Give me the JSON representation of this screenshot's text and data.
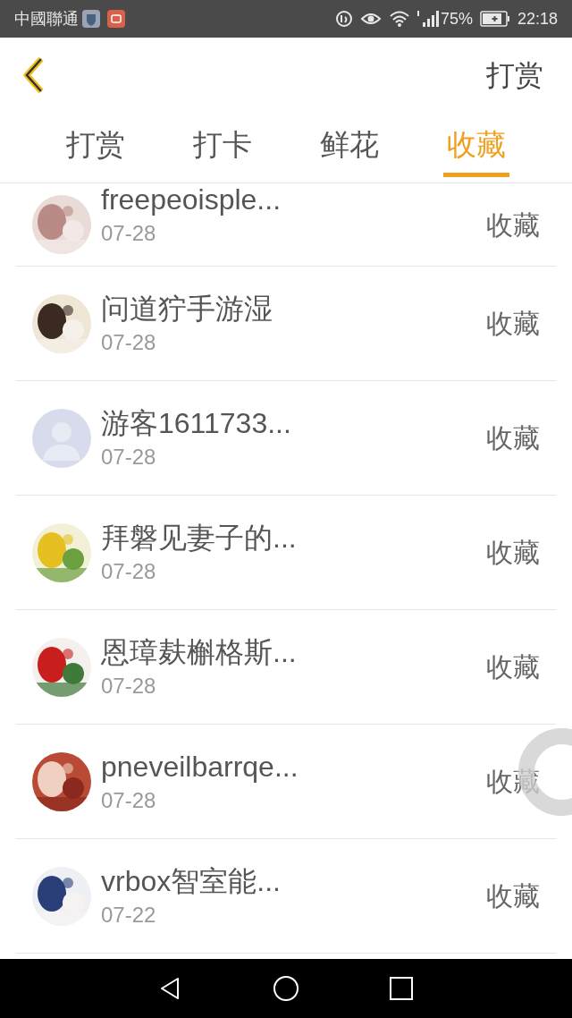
{
  "status_bar": {
    "carrier": "中國聯通",
    "battery": "75%",
    "time": "22:18"
  },
  "header": {
    "title": "打赏"
  },
  "tabs": [
    {
      "label": "打赏",
      "selected": false
    },
    {
      "label": "打卡",
      "selected": false
    },
    {
      "label": "鲜花",
      "selected": false
    },
    {
      "label": "收藏",
      "selected": true
    }
  ],
  "rows": [
    {
      "name": "freepeoisple...",
      "date": "07-28",
      "action": "收藏"
    },
    {
      "name": "问道狞手游湿",
      "date": "07-28",
      "action": "收藏"
    },
    {
      "name": "游客1611733...",
      "date": "07-28",
      "action": "收藏",
      "avatar": {
        "kind": "default"
      }
    },
    {
      "name": "拜磐见妻子的...",
      "date": "07-28",
      "action": "收藏"
    },
    {
      "name": "恩璋麸槲格斯...",
      "date": "07-28",
      "action": "收藏"
    },
    {
      "name": "pneveilbarrqe...",
      "date": "07-28",
      "action": "收藏"
    },
    {
      "name": "vrbox智室能...",
      "date": "07-22",
      "action": "收藏"
    }
  ]
}
